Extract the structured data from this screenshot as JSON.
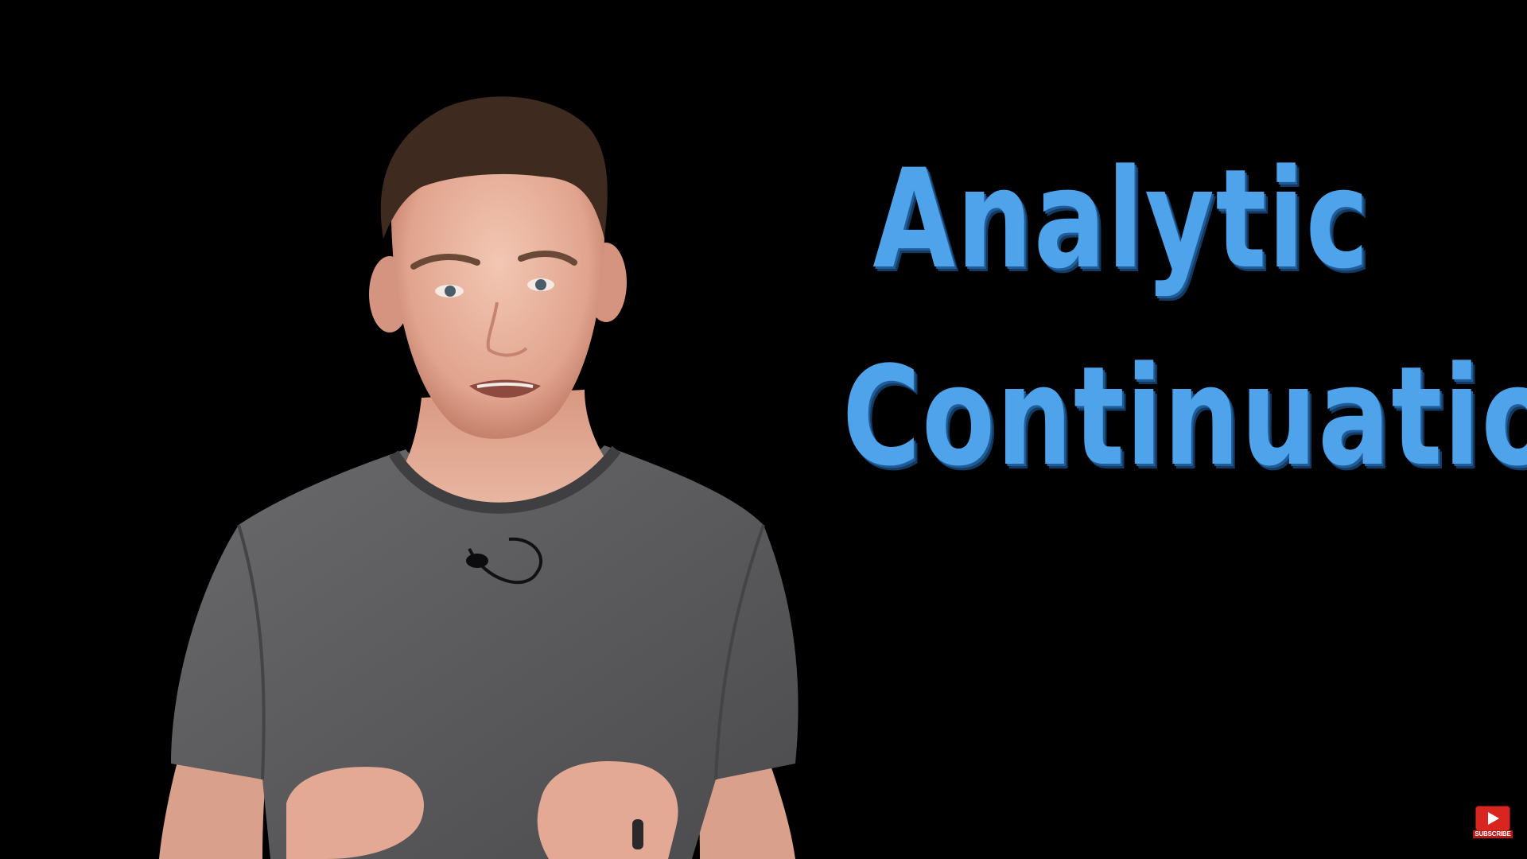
{
  "title": {
    "line1": "Analytic",
    "line2": "Continuation"
  },
  "subscribe": {
    "label": "SUBSCRIBE"
  },
  "colors": {
    "background": "#000000",
    "title_text": "#4ea3ea",
    "subscribe_red": "#d92520",
    "shirt": "#5a5a5c"
  }
}
